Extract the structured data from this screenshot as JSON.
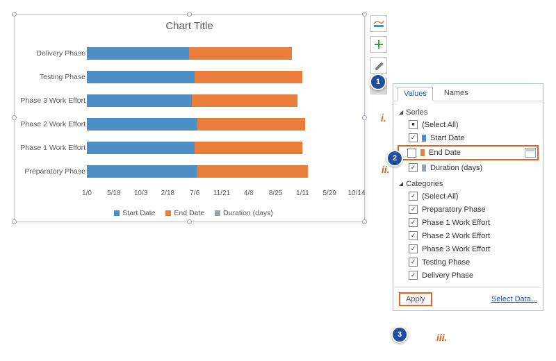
{
  "chart_data": {
    "type": "bar",
    "orientation": "horizontal",
    "stacked": true,
    "title": "Chart Title",
    "xlabel": "",
    "ylabel": "",
    "x_ticks": [
      "1/0",
      "5/18",
      "10/3",
      "2/18",
      "7/6",
      "11/21",
      "4/8",
      "8/25",
      "1/11",
      "5/29",
      "10/14"
    ],
    "categories_top_to_bottom": [
      "Delivery Phase",
      "Testing Phase",
      "Phase 3 Work Effort",
      "Phase 2 Work Effort",
      "Phase 1 Work Effort",
      "Preparatory Phase"
    ],
    "series": [
      {
        "name": "Start Date",
        "color": "#4c8ec6"
      },
      {
        "name": "End Date",
        "color": "#e87d3c"
      },
      {
        "name": "Duration (days)",
        "color": "#9aa0a6"
      }
    ],
    "bars": [
      {
        "category": "Delivery Phase",
        "start_tick": 0,
        "start_end_tick": 3.8,
        "end_tick": 7.6
      },
      {
        "category": "Testing Phase",
        "start_tick": 0,
        "start_end_tick": 4.0,
        "end_tick": 8.0
      },
      {
        "category": "Phase 3 Work Effort",
        "start_tick": 0,
        "start_end_tick": 3.9,
        "end_tick": 7.8
      },
      {
        "category": "Phase 2 Work Effort",
        "start_tick": 0,
        "start_end_tick": 4.1,
        "end_tick": 8.1
      },
      {
        "category": "Phase 1 Work Effort",
        "start_tick": 0,
        "start_end_tick": 4.0,
        "end_tick": 8.0
      },
      {
        "category": "Preparatory Phase",
        "start_tick": 0,
        "start_end_tick": 4.1,
        "end_tick": 8.2
      }
    ],
    "x_tick_count": 11
  },
  "legend": {
    "s1": "Start Date",
    "s2": "End Date",
    "s3": "Duration (days)"
  },
  "callouts": {
    "num1": "1",
    "num2": "2",
    "num3": "3",
    "i": "i.",
    "ii": "ii.",
    "iii": "iii."
  },
  "filter_panel": {
    "tabs": {
      "values": "Values",
      "names": "Names"
    },
    "series_hdr": "Series",
    "series_items": {
      "select_all": "(Select All)",
      "start_date": "Start Date",
      "end_date": "End Date",
      "duration": "Duration (days)"
    },
    "cat_hdr": "Categories",
    "cat_items": {
      "select_all": "(Select All)",
      "c1": "Preparatory Phase",
      "c2": "Phase 1 Work Effort",
      "c3": "Phase 2 Work Effort",
      "c4": "Phase 3 Work Effort",
      "c5": "Testing Phase",
      "c6": "Delivery Phase"
    },
    "apply": "Apply",
    "select_data": "Select Data..."
  }
}
